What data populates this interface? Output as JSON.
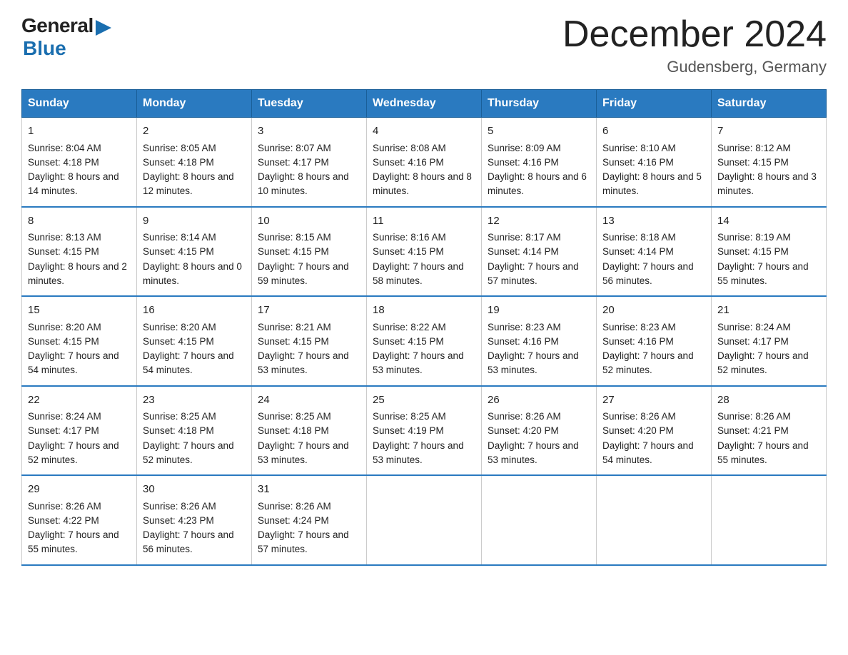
{
  "logo": {
    "general": "General",
    "blue": "Blue"
  },
  "title": "December 2024",
  "subtitle": "Gudensberg, Germany",
  "headers": [
    "Sunday",
    "Monday",
    "Tuesday",
    "Wednesday",
    "Thursday",
    "Friday",
    "Saturday"
  ],
  "weeks": [
    [
      {
        "day": "1",
        "sunrise": "8:04 AM",
        "sunset": "4:18 PM",
        "daylight": "8 hours and 14 minutes."
      },
      {
        "day": "2",
        "sunrise": "8:05 AM",
        "sunset": "4:18 PM",
        "daylight": "8 hours and 12 minutes."
      },
      {
        "day": "3",
        "sunrise": "8:07 AM",
        "sunset": "4:17 PM",
        "daylight": "8 hours and 10 minutes."
      },
      {
        "day": "4",
        "sunrise": "8:08 AM",
        "sunset": "4:16 PM",
        "daylight": "8 hours and 8 minutes."
      },
      {
        "day": "5",
        "sunrise": "8:09 AM",
        "sunset": "4:16 PM",
        "daylight": "8 hours and 6 minutes."
      },
      {
        "day": "6",
        "sunrise": "8:10 AM",
        "sunset": "4:16 PM",
        "daylight": "8 hours and 5 minutes."
      },
      {
        "day": "7",
        "sunrise": "8:12 AM",
        "sunset": "4:15 PM",
        "daylight": "8 hours and 3 minutes."
      }
    ],
    [
      {
        "day": "8",
        "sunrise": "8:13 AM",
        "sunset": "4:15 PM",
        "daylight": "8 hours and 2 minutes."
      },
      {
        "day": "9",
        "sunrise": "8:14 AM",
        "sunset": "4:15 PM",
        "daylight": "8 hours and 0 minutes."
      },
      {
        "day": "10",
        "sunrise": "8:15 AM",
        "sunset": "4:15 PM",
        "daylight": "7 hours and 59 minutes."
      },
      {
        "day": "11",
        "sunrise": "8:16 AM",
        "sunset": "4:15 PM",
        "daylight": "7 hours and 58 minutes."
      },
      {
        "day": "12",
        "sunrise": "8:17 AM",
        "sunset": "4:14 PM",
        "daylight": "7 hours and 57 minutes."
      },
      {
        "day": "13",
        "sunrise": "8:18 AM",
        "sunset": "4:14 PM",
        "daylight": "7 hours and 56 minutes."
      },
      {
        "day": "14",
        "sunrise": "8:19 AM",
        "sunset": "4:15 PM",
        "daylight": "7 hours and 55 minutes."
      }
    ],
    [
      {
        "day": "15",
        "sunrise": "8:20 AM",
        "sunset": "4:15 PM",
        "daylight": "7 hours and 54 minutes."
      },
      {
        "day": "16",
        "sunrise": "8:20 AM",
        "sunset": "4:15 PM",
        "daylight": "7 hours and 54 minutes."
      },
      {
        "day": "17",
        "sunrise": "8:21 AM",
        "sunset": "4:15 PM",
        "daylight": "7 hours and 53 minutes."
      },
      {
        "day": "18",
        "sunrise": "8:22 AM",
        "sunset": "4:15 PM",
        "daylight": "7 hours and 53 minutes."
      },
      {
        "day": "19",
        "sunrise": "8:23 AM",
        "sunset": "4:16 PM",
        "daylight": "7 hours and 53 minutes."
      },
      {
        "day": "20",
        "sunrise": "8:23 AM",
        "sunset": "4:16 PM",
        "daylight": "7 hours and 52 minutes."
      },
      {
        "day": "21",
        "sunrise": "8:24 AM",
        "sunset": "4:17 PM",
        "daylight": "7 hours and 52 minutes."
      }
    ],
    [
      {
        "day": "22",
        "sunrise": "8:24 AM",
        "sunset": "4:17 PM",
        "daylight": "7 hours and 52 minutes."
      },
      {
        "day": "23",
        "sunrise": "8:25 AM",
        "sunset": "4:18 PM",
        "daylight": "7 hours and 52 minutes."
      },
      {
        "day": "24",
        "sunrise": "8:25 AM",
        "sunset": "4:18 PM",
        "daylight": "7 hours and 53 minutes."
      },
      {
        "day": "25",
        "sunrise": "8:25 AM",
        "sunset": "4:19 PM",
        "daylight": "7 hours and 53 minutes."
      },
      {
        "day": "26",
        "sunrise": "8:26 AM",
        "sunset": "4:20 PM",
        "daylight": "7 hours and 53 minutes."
      },
      {
        "day": "27",
        "sunrise": "8:26 AM",
        "sunset": "4:20 PM",
        "daylight": "7 hours and 54 minutes."
      },
      {
        "day": "28",
        "sunrise": "8:26 AM",
        "sunset": "4:21 PM",
        "daylight": "7 hours and 55 minutes."
      }
    ],
    [
      {
        "day": "29",
        "sunrise": "8:26 AM",
        "sunset": "4:22 PM",
        "daylight": "7 hours and 55 minutes."
      },
      {
        "day": "30",
        "sunrise": "8:26 AM",
        "sunset": "4:23 PM",
        "daylight": "7 hours and 56 minutes."
      },
      {
        "day": "31",
        "sunrise": "8:26 AM",
        "sunset": "4:24 PM",
        "daylight": "7 hours and 57 minutes."
      },
      null,
      null,
      null,
      null
    ]
  ]
}
